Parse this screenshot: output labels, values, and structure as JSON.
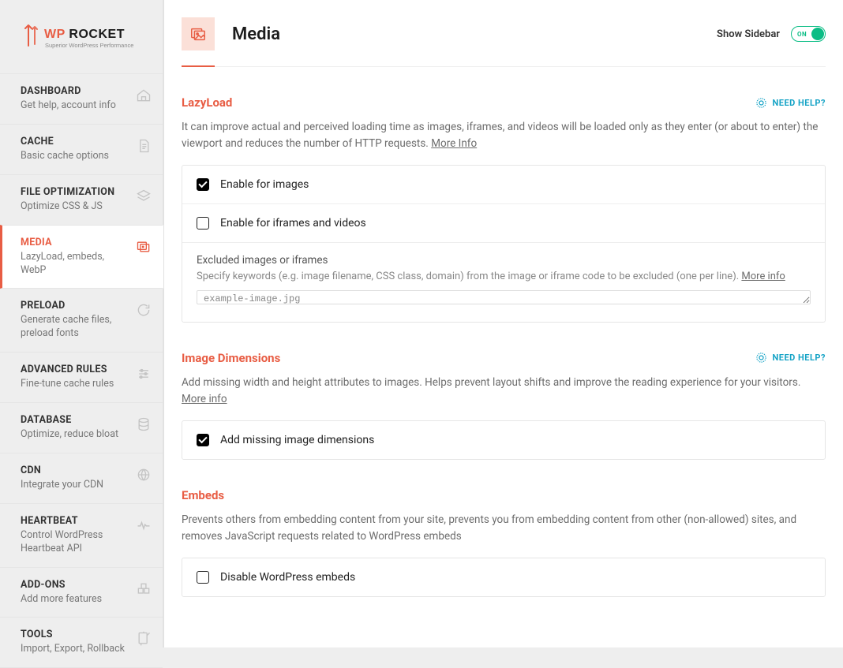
{
  "brand": {
    "name": "WP ROCKET",
    "tagline": "Superior WordPress Performance"
  },
  "nav": [
    {
      "title": "DASHBOARD",
      "sub": "Get help, account info",
      "icon": "home"
    },
    {
      "title": "CACHE",
      "sub": "Basic cache options",
      "icon": "file"
    },
    {
      "title": "FILE OPTIMIZATION",
      "sub": "Optimize CSS & JS",
      "icon": "layers"
    },
    {
      "title": "MEDIA",
      "sub": "LazyLoad, embeds, WebP",
      "icon": "media",
      "active": true
    },
    {
      "title": "PRELOAD",
      "sub": "Generate cache files, preload fonts",
      "icon": "refresh"
    },
    {
      "title": "ADVANCED RULES",
      "sub": "Fine-tune cache rules",
      "icon": "sliders"
    },
    {
      "title": "DATABASE",
      "sub": "Optimize, reduce bloat",
      "icon": "database"
    },
    {
      "title": "CDN",
      "sub": "Integrate your CDN",
      "icon": "globe"
    },
    {
      "title": "HEARTBEAT",
      "sub": "Control WordPress Heartbeat API",
      "icon": "heartbeat"
    },
    {
      "title": "ADD-ONS",
      "sub": "Add more features",
      "icon": "addons"
    },
    {
      "title": "TOOLS",
      "sub": "Import, Export, Rollback",
      "icon": "tools"
    }
  ],
  "header": {
    "title": "Media",
    "show_sidebar_label": "Show Sidebar",
    "toggle_text": "ON"
  },
  "help_label": "NEED HELP?",
  "lazyload": {
    "title": "LazyLoad",
    "desc_pre": "It can improve actual and perceived loading time as images, iframes, and videos will be loaded only as they enter (or about to enter) the viewport and reduces the number of HTTP requests. ",
    "more_info": "More Info",
    "opt_images": "Enable for images",
    "opt_iframes": "Enable for iframes and videos",
    "excluded_label": "Excluded images or iframes",
    "excluded_desc_pre": "Specify keywords (e.g. image filename, CSS class, domain) from the image or iframe code to be excluded (one per line). ",
    "excluded_more": "More info",
    "textarea_value": "example-image.jpg",
    "chk_images": true,
    "chk_iframes": false
  },
  "dimensions": {
    "title": "Image Dimensions",
    "desc_pre": "Add missing width and height attributes to images. Helps prevent layout shifts and improve the reading experience for your visitors. ",
    "more_info": "More info",
    "opt_label": "Add missing image dimensions",
    "chk": true
  },
  "embeds": {
    "title": "Embeds",
    "desc": "Prevents others from embedding content from your site, prevents you from embedding content from other (non-allowed) sites, and removes JavaScript requests related to WordPress embeds",
    "opt_label": "Disable WordPress embeds",
    "chk": false
  }
}
